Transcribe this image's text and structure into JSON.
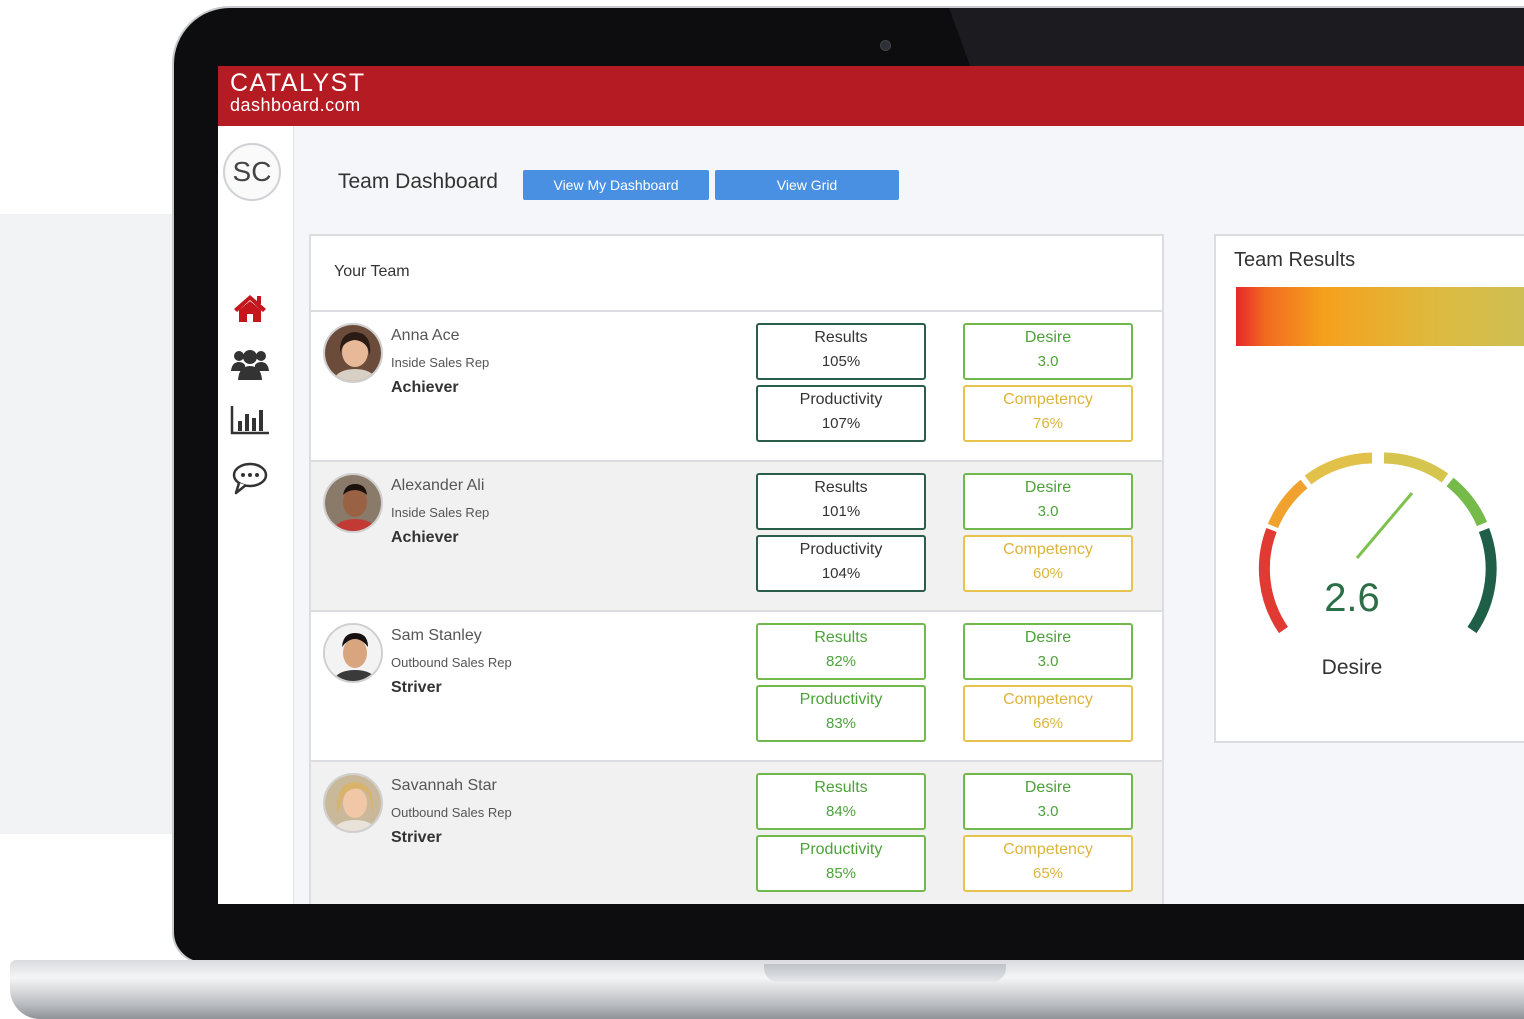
{
  "brand": {
    "name": "CATALYST",
    "sub": "dashboard.com"
  },
  "user": {
    "initials": "SC"
  },
  "nav": [
    {
      "icon": "home-icon",
      "color": "#c4161c"
    },
    {
      "icon": "users-icon",
      "color": "#333333"
    },
    {
      "icon": "bar-chart-icon",
      "color": "#333333"
    },
    {
      "icon": "chat-icon",
      "color": "#333333"
    }
  ],
  "header": {
    "title": "Team Dashboard",
    "buttons": {
      "dashboard": "View My Dashboard",
      "grid": "View Grid"
    }
  },
  "team": {
    "title": "Your Team",
    "members": [
      {
        "name": "Anna Ace",
        "role": "Inside Sales Rep",
        "tag": "Achiever",
        "results": {
          "label": "Results",
          "value": "105%"
        },
        "productivity": {
          "label": "Productivity",
          "value": "107%"
        },
        "desire": {
          "label": "Desire",
          "value": "3.0"
        },
        "competency": {
          "label": "Competency",
          "value": "76%"
        }
      },
      {
        "name": "Alexander Ali",
        "role": "Inside Sales Rep",
        "tag": "Achiever",
        "results": {
          "label": "Results",
          "value": "101%"
        },
        "productivity": {
          "label": "Productivity",
          "value": "104%"
        },
        "desire": {
          "label": "Desire",
          "value": "3.0"
        },
        "competency": {
          "label": "Competency",
          "value": "60%"
        }
      },
      {
        "name": "Sam Stanley",
        "role": "Outbound Sales Rep",
        "tag": "Striver",
        "results": {
          "label": "Results",
          "value": "82%"
        },
        "productivity": {
          "label": "Productivity",
          "value": "83%"
        },
        "desire": {
          "label": "Desire",
          "value": "3.0"
        },
        "competency": {
          "label": "Competency",
          "value": "66%"
        }
      },
      {
        "name": "Savannah Star",
        "role": "Outbound Sales Rep",
        "tag": "Striver",
        "results": {
          "label": "Results",
          "value": "84%"
        },
        "productivity": {
          "label": "Productivity",
          "value": "85%"
        },
        "desire": {
          "label": "Desire",
          "value": "3.0"
        },
        "competency": {
          "label": "Competency",
          "value": "65%"
        }
      }
    ]
  },
  "results": {
    "title": "Team Results",
    "gauge": {
      "value": "2.6",
      "label": "Desire"
    }
  },
  "colors": {
    "brand_red": "#b51b23",
    "button_blue": "#4a90e2",
    "dark_green": "#2a5d4a",
    "light_green": "#72b94d",
    "yellow": "#e8c34b"
  }
}
